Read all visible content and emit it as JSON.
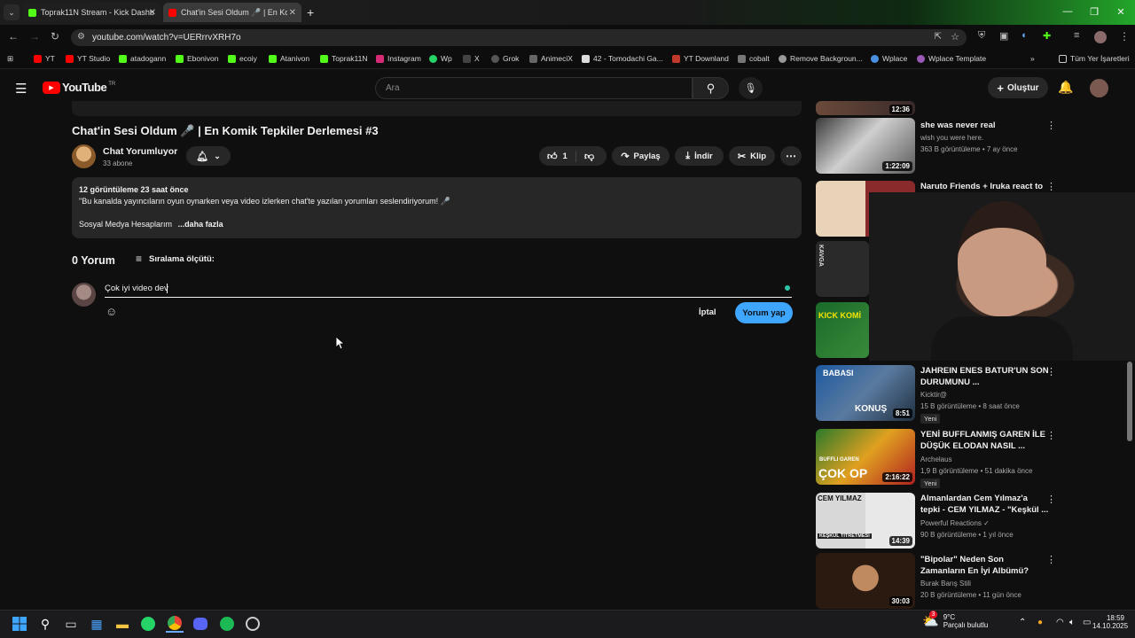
{
  "browser": {
    "tabs": [
      {
        "label": "Toprak11N Stream - Kick Dashb"
      },
      {
        "label": "Chat'in Sesi Oldum 🎤 | En Kom"
      }
    ],
    "url": "youtube.com/watch?v=UERrrvXRH7o",
    "bookmarks": [
      "YT",
      "YT Studio",
      "atadogann",
      "Ebonivon",
      "ecoiy",
      "Atanivon",
      "Toprak11N",
      "Instagram",
      "Wp",
      "X",
      "Grok",
      "AnimeciX",
      "42 - Tomodachi Ga...",
      "YT Downland",
      "cobalt",
      "Remove Backgroun...",
      "Wplace",
      "Wplace Template"
    ],
    "all_bookmarks": "Tüm Yer İşaretleri"
  },
  "youtube": {
    "logo_text": "YouTube",
    "region": "TR",
    "search_placeholder": "Ara",
    "create_label": "Oluştur",
    "video": {
      "title": "Chat'in Sesi Oldum 🎤 | En Komik Tepkiler Derlemesi #3",
      "channel": "Chat Yorumluyor",
      "subscribers": "33 abone",
      "likes": "1",
      "share": "Paylaş",
      "download": "İndir",
      "clip": "Klip",
      "views_time": "12 görüntüleme  23 saat önce",
      "description": "\"Bu kanalda yayıncıların oyun oynarken veya video izlerken chat'te yazılan yorumları  seslendiriyorum! 🎤",
      "description2": "Sosyal Medya Hesaplarım",
      "more": "...daha fazla"
    },
    "comments": {
      "count_label": "0 Yorum",
      "sort_label": "Sıralama ölçütü:",
      "draft": "Çok iyi video dev",
      "cancel": "İptal",
      "submit": "Yorum yap"
    },
    "recommended": [
      {
        "title": "she was never real",
        "channel": "wish you were here.",
        "meta": "363 B görüntüleme • 7 ay önce",
        "duration": "1:22:09"
      },
      {
        "title": "Naruto Friends + Iruka react to",
        "channel": "",
        "meta": "",
        "duration": ""
      },
      {
        "title": "JAHREIN ENES BATUR'UN SON DURUMUNU ...",
        "channel": "Kicktir@",
        "meta": "15 B görüntüleme • 8 saat önce",
        "duration": "8:51",
        "badge": "Yeni"
      },
      {
        "title": "YENİ BUFFLANMIŞ GAREN İLE DÜŞÜK ELODAN NASIL ...",
        "channel": "Archelaus",
        "meta": "1,9 B görüntüleme • 51 dakika önce",
        "duration": "2:16:22",
        "badge": "Yeni"
      },
      {
        "title": "Almanlardan Cem Yılmaz'a tepki - CEM YILMAZ - \"Keşkül ...",
        "channel": "Powerful Reactions ✓",
        "meta": "90 B görüntüleme • 1 yıl önce",
        "duration": "14:39"
      },
      {
        "title": "\"Bipolar\" Neden Son Zamanların En İyi Albümü?",
        "channel": "Burak Barış Stili",
        "meta": "20 B görüntüleme • 11 gün önce",
        "duration": "30:03"
      }
    ],
    "top_thumb_duration": "12:36",
    "thumb_texts": {
      "babasi": "BABASI",
      "konus": "KONUŞ",
      "garen_top": "BUFFLI GAREN",
      "garen": "ÇOK OP",
      "cem": "CEM YILMAZ",
      "keskul": "KEŞKÜL TİTRETMESİ",
      "kick": "KICK KOMİ",
      "kavga": "KAVGA"
    }
  },
  "taskbar": {
    "weather_temp": "9°C",
    "weather_text": "Parçalı bulutlu",
    "weather_badge": "3",
    "time": "18:59",
    "date": "14.10.2025"
  },
  "colors": {
    "accent": "#3ea6ff",
    "like_bg": "#272727",
    "bg": "#0f0f0f"
  }
}
